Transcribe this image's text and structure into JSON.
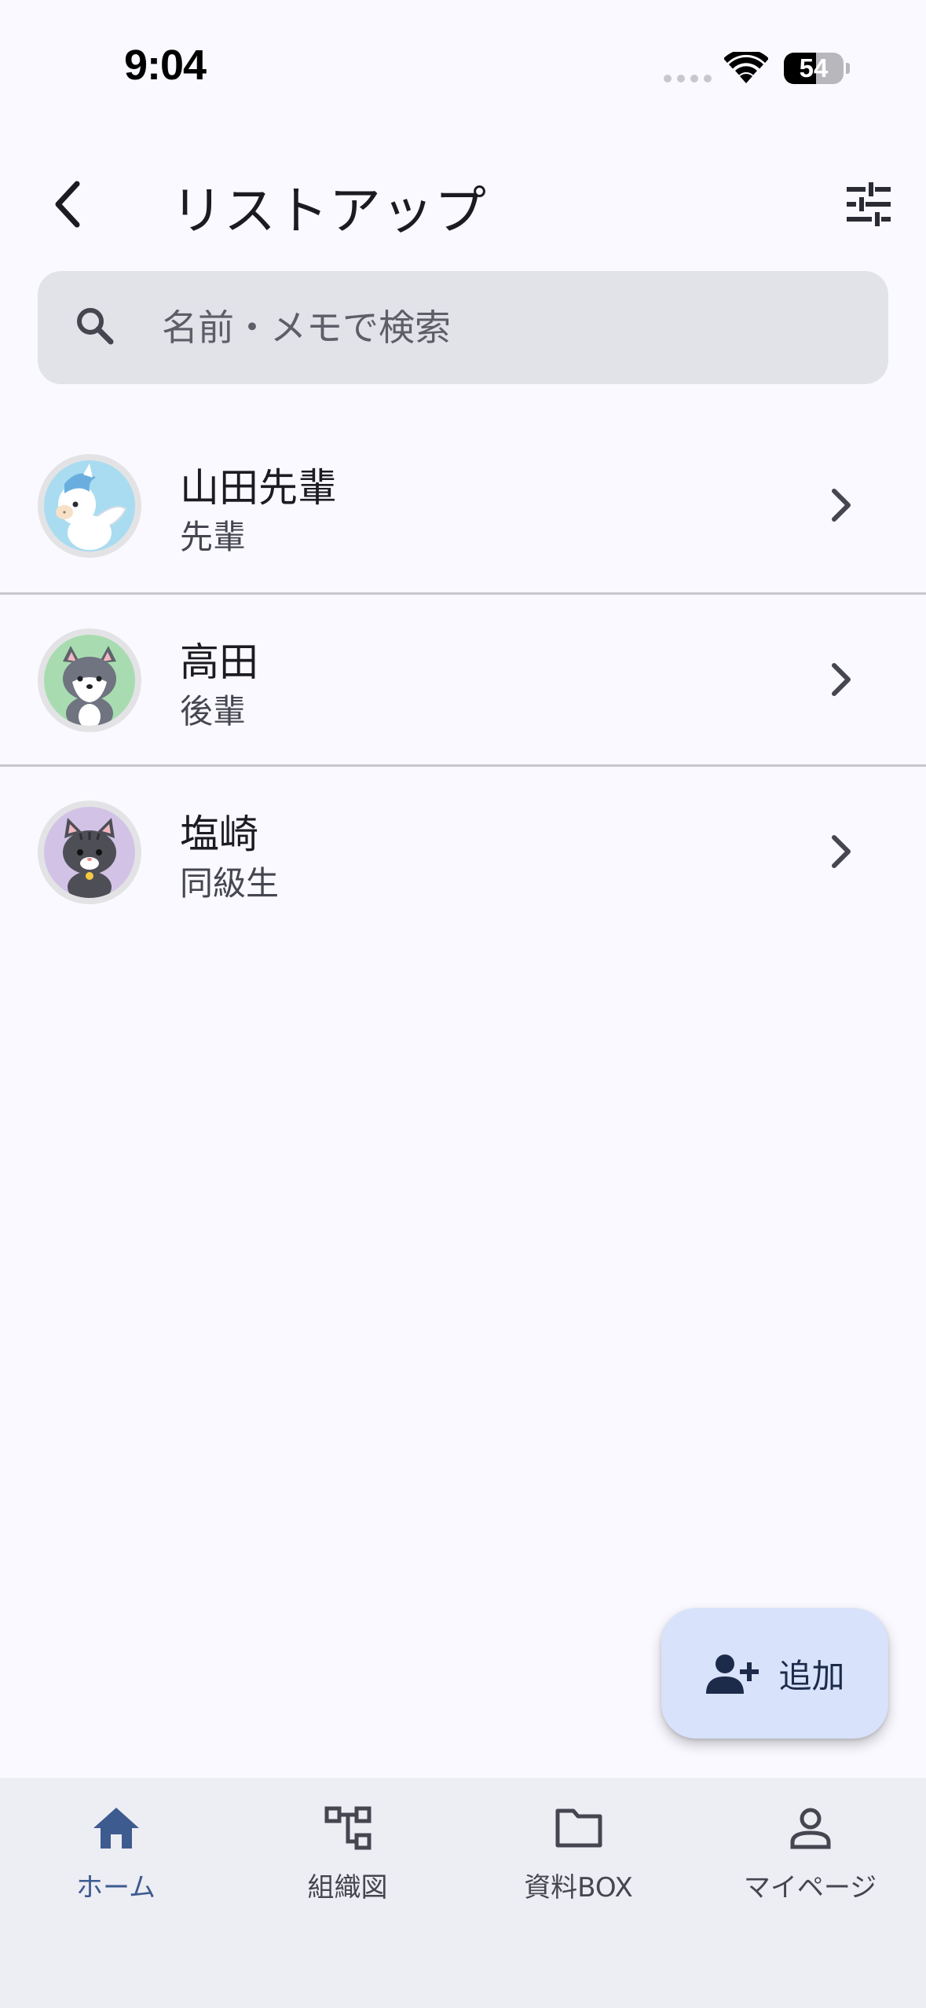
{
  "status_bar": {
    "time": "9:04",
    "battery": "54",
    "battery_level": 0.54
  },
  "header": {
    "title": "リストアップ",
    "back_icon": "chevron-left-icon",
    "filter_icon": "tune-icon"
  },
  "search": {
    "placeholder": "名前・メモで検索",
    "value": ""
  },
  "contacts": [
    {
      "name": "山田先輩",
      "relation": "先輩",
      "avatar": "pegasus-avatar",
      "avatar_bg": "#a9dcf0"
    },
    {
      "name": "高田",
      "relation": "後輩",
      "avatar": "wolf-avatar",
      "avatar_bg": "#a8dcb0"
    },
    {
      "name": "塩崎",
      "relation": "同級生",
      "avatar": "cat-avatar",
      "avatar_bg": "#d2c3e6"
    }
  ],
  "fab": {
    "label": "追加",
    "icon": "person-add-icon"
  },
  "bottom_nav": [
    {
      "label": "ホーム",
      "icon": "home-icon",
      "active": true
    },
    {
      "label": "組織図",
      "icon": "org-chart-icon",
      "active": false
    },
    {
      "label": "資料BOX",
      "icon": "folder-icon",
      "active": false
    },
    {
      "label": "マイページ",
      "icon": "person-icon",
      "active": false
    }
  ],
  "colors": {
    "background": "#f9f9ff",
    "accent": "#3d5b8f",
    "fab_bg": "#d8e2fb",
    "nav_bg": "#ededf4",
    "search_bg": "#e2e2e9"
  }
}
